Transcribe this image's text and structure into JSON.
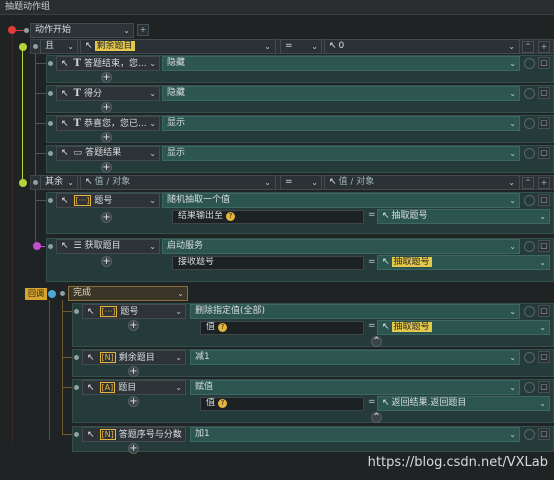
{
  "window": {
    "title": "抽题动作组"
  },
  "root": {
    "label": "动作开始"
  },
  "if_block": {
    "kind": "且",
    "left": "剩余题目",
    "op": "=",
    "right": "0",
    "items": [
      {
        "name": "答题结束，您...",
        "icon": "text-icon",
        "value": "隐藏"
      },
      {
        "name": "得分",
        "icon": "text-icon",
        "value": "隐藏"
      },
      {
        "name": "恭喜您，您已...",
        "icon": "text-icon",
        "value": "显示"
      },
      {
        "name": "答题结果",
        "icon": "slideshow-icon",
        "value": "显示"
      }
    ]
  },
  "else_block": {
    "kind": "其余",
    "left_placeholder": "值 / 对象",
    "op": "=",
    "right_placeholder": "值 / 对象",
    "item1": {
      "name": "题号",
      "action": "随机抽取一个值",
      "param_label": "结果输出至",
      "param_value": "抽取题号"
    },
    "item2": {
      "name": "获取题目",
      "action": "启动服务",
      "param_label": "接收题号",
      "param_value": "抽取题号"
    }
  },
  "callback": {
    "badge": "回调",
    "event": "完成",
    "items": [
      {
        "name": "题号",
        "action": "删除指定值(全部)",
        "param_label": "值",
        "param_value": "抽取题号"
      },
      {
        "name": "剩余题目",
        "action": "减1"
      },
      {
        "name": "题目",
        "action": "赋值",
        "param_label": "值",
        "param_value": "返回结果.返回题目"
      },
      {
        "name": "答题序号与分数",
        "action": "加1"
      }
    ]
  },
  "watermark": "https://blog.csdn.net/VXLab",
  "colors": {
    "accent_green": "#b6d43a",
    "accent_orange": "#d6a52e",
    "accent_magenta": "#c14ccf",
    "accent_red": "#e03a3a",
    "highlight": "#e3c84a"
  }
}
